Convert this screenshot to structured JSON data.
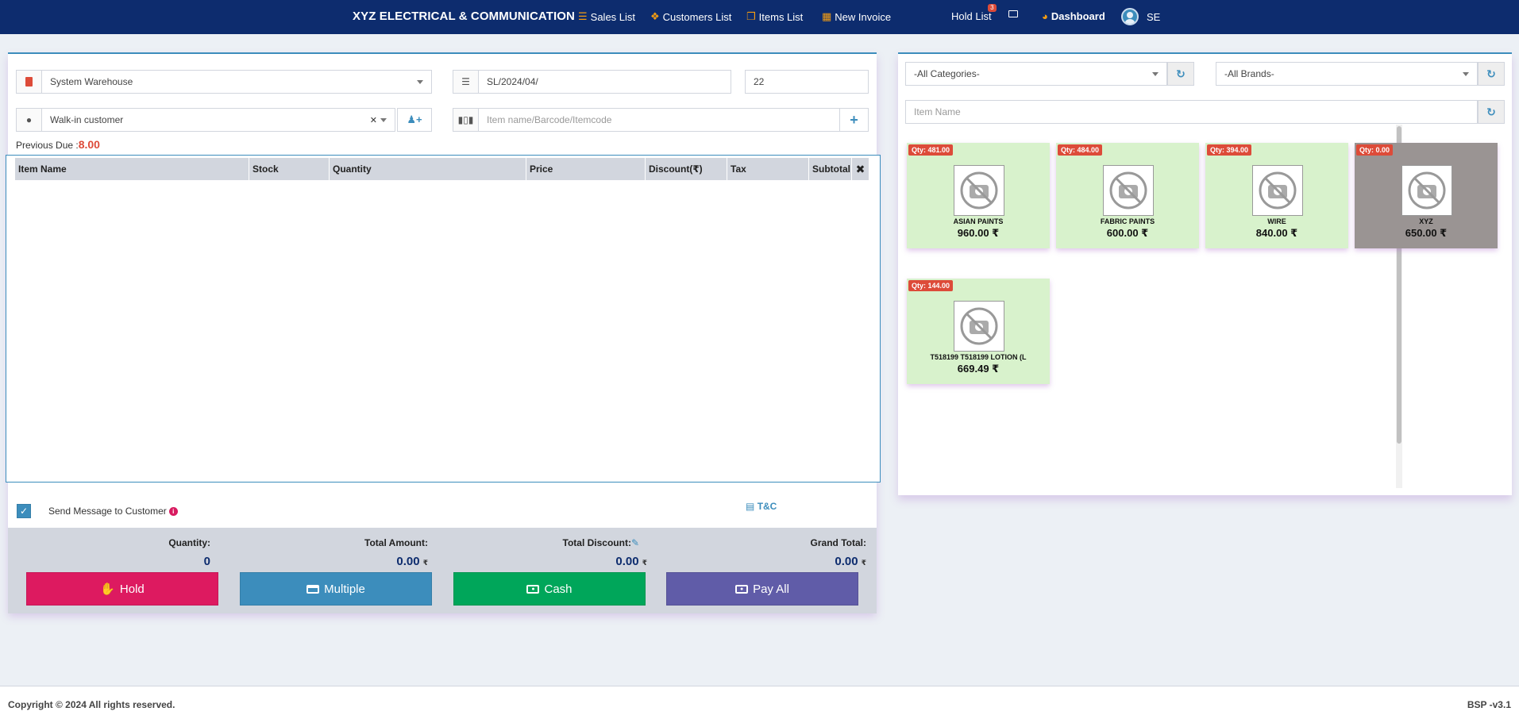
{
  "header": {
    "brand": "XYZ ELECTRICAL & COMMUNICATION",
    "nav": {
      "sales_list": "Sales List",
      "customers_list": "Customers List",
      "items_list": "Items List",
      "new_invoice": "New Invoice",
      "hold_list": "Hold List",
      "hold_count": "3",
      "dashboard": "Dashboard",
      "user": "SE"
    }
  },
  "form": {
    "warehouse": "System Warehouse",
    "invoice_prefix": "SL/2024/04/",
    "invoice_number": "22",
    "customer": "Walk-in customer",
    "item_search_placeholder": "Item name/Barcode/Itemcode",
    "previous_due_label": "Previous Due :",
    "previous_due_value": "8.00"
  },
  "table": {
    "columns": [
      "Item Name",
      "Stock",
      "Quantity",
      "Price",
      "Discount(₹)",
      "Tax",
      "Subtotal"
    ],
    "rows": []
  },
  "options": {
    "send_message_label": "Send Message to Customer",
    "send_message_checked": true,
    "tc_label": "T&C"
  },
  "totals": {
    "quantity_label": "Quantity:",
    "quantity_value": "0",
    "total_amount_label": "Total Amount:",
    "total_amount_value": "0.00",
    "total_discount_label": "Total Discount:",
    "total_discount_value": "0.00",
    "grand_total_label": "Grand Total:",
    "grand_total_value": "0.00",
    "currency": "₹"
  },
  "actions": {
    "hold": "Hold",
    "multiple": "Multiple",
    "cash": "Cash",
    "pay_all": "Pay All"
  },
  "colors": {
    "navbar": "#0d2c6e",
    "hold": "#dd1a60",
    "multiple": "#3c8dbc",
    "cash": "#00a65a",
    "pay_all": "#605ca8"
  },
  "filters": {
    "category": "-All Categories-",
    "brand": "-All Brands-",
    "item_name_placeholder": "Item Name"
  },
  "products": [
    {
      "qty": "Qty: 481.00",
      "name": "ASIAN PAINTS",
      "price": "960.00 ₹",
      "in_stock": true
    },
    {
      "qty": "Qty: 484.00",
      "name": "FABRIC PAINTS",
      "price": "600.00 ₹",
      "in_stock": true
    },
    {
      "qty": "Qty: 394.00",
      "name": "WIRE",
      "price": "840.00 ₹",
      "in_stock": true
    },
    {
      "qty": "Qty: 0.00",
      "name": "XYZ",
      "price": "650.00 ₹",
      "in_stock": false
    },
    {
      "qty": "Qty: 144.00",
      "name": "T518199 T518199 LOTION (L",
      "price": "669.49 ₹",
      "in_stock": true
    }
  ],
  "footer": {
    "copyright": "Copyright © 2024 All rights reserved.",
    "version": "BSP -v3.1"
  }
}
